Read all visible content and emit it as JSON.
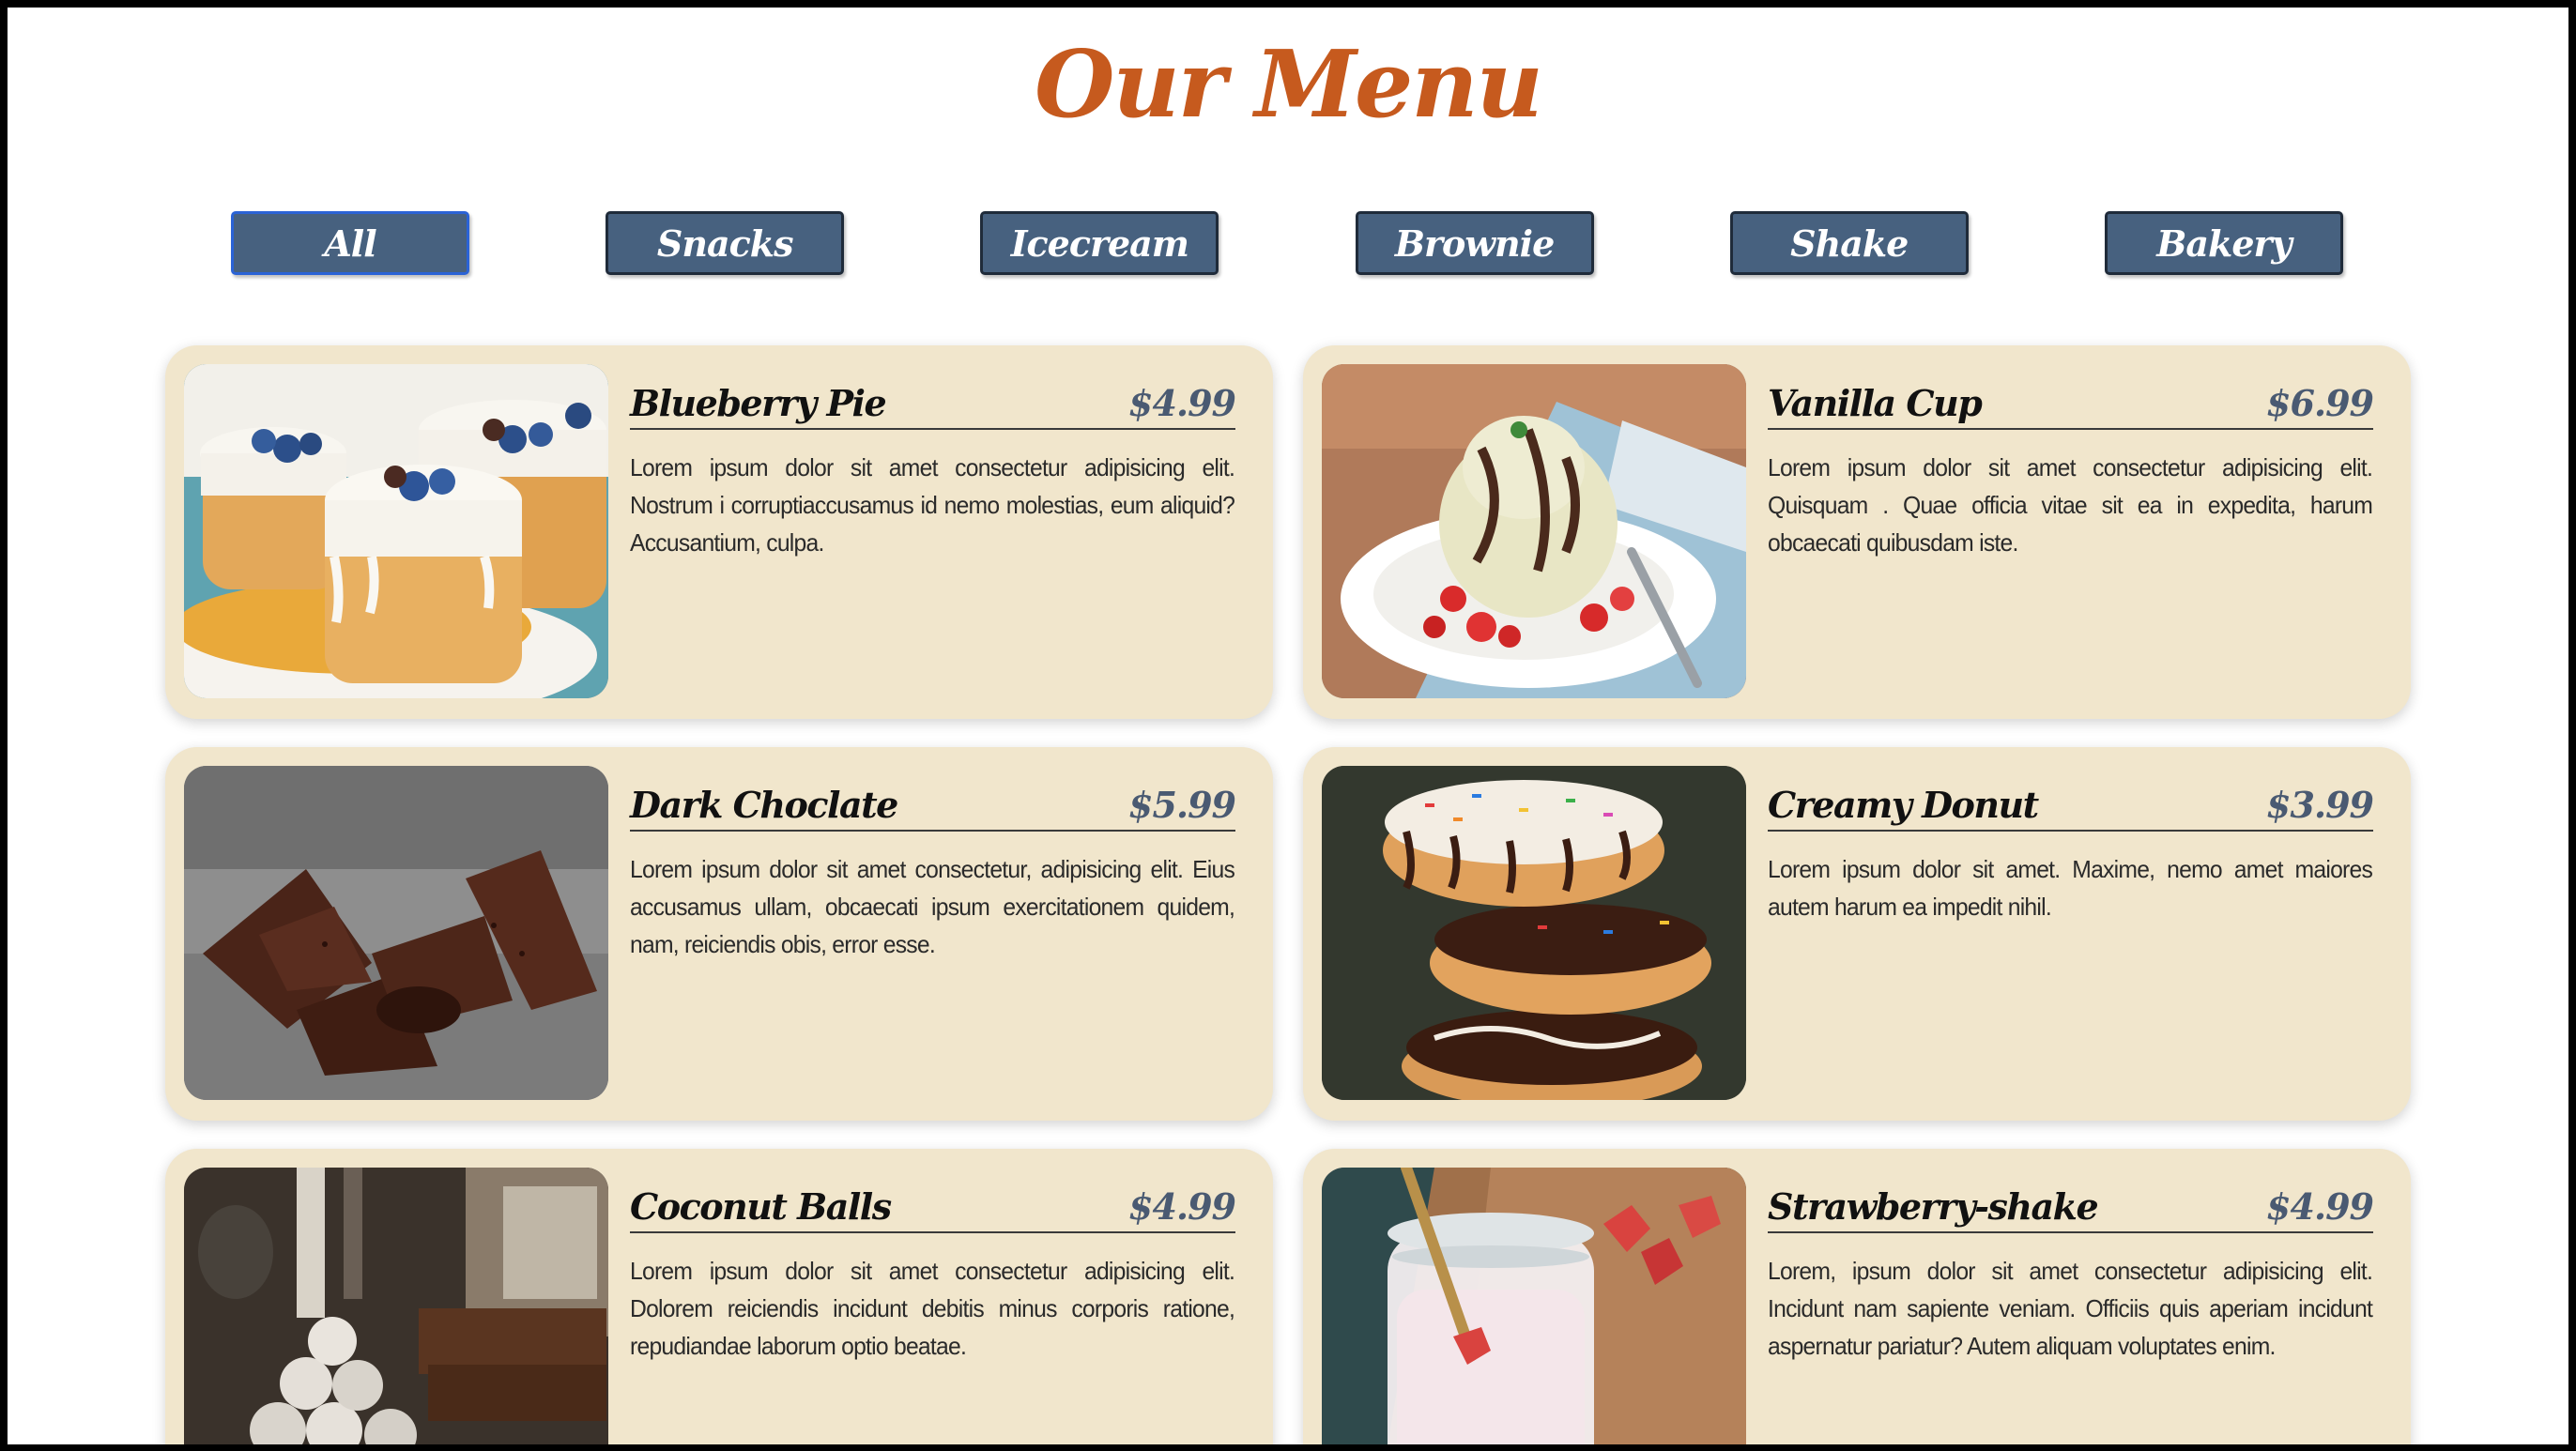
{
  "page": {
    "title": "Our Menu"
  },
  "filters": [
    {
      "label": "All",
      "active": true
    },
    {
      "label": "Snacks",
      "active": false
    },
    {
      "label": "Icecream",
      "active": false
    },
    {
      "label": "Brownie",
      "active": false
    },
    {
      "label": "Shake",
      "active": false
    },
    {
      "label": "Bakery",
      "active": false
    }
  ],
  "items": [
    {
      "name": "Blueberry Pie",
      "price": "$4.99",
      "image": "blueberry-pie-photo",
      "description": "Lorem ipsum dolor sit amet consectetur adipisicing elit. Nostrum i corruptiaccusamus id nemo molestias, eum aliquid? Accusantium, culpa."
    },
    {
      "name": "Vanilla Cup",
      "price": "$6.99",
      "image": "vanilla-icecream-photo",
      "description": "Lorem ipsum dolor sit amet consectetur adipisicing elit. Quisquam . Quae officia vitae sit ea in expedita, harum obcaecati quibusdam iste."
    },
    {
      "name": "Dark Choclate",
      "price": "$5.99",
      "image": "chocolate-brownie-photo",
      "description": "Lorem ipsum dolor sit amet consectetur, adipisicing elit. Eius accusamus ullam, obcaecati ipsum exercitationem quidem, nam, reiciendis obis, error esse."
    },
    {
      "name": "Creamy Donut",
      "price": "$3.99",
      "image": "donut-stack-photo",
      "description": "Lorem ipsum dolor sit amet. Maxime, nemo amet maiores autem harum ea impedit nihil."
    },
    {
      "name": "Coconut Balls",
      "price": "$4.99",
      "image": "coconut-balls-photo",
      "description": "Lorem ipsum dolor sit amet consectetur adipisicing elit. Dolorem reiciendis incidunt debitis minus corporis ratione, repudiandae laborum optio beatae."
    },
    {
      "name": "Strawberry-shake",
      "price": "$4.99",
      "image": "strawberry-shake-photo",
      "description": "Lorem, ipsum dolor sit amet consectetur adipisicing elit. Incidunt nam sapiente veniam. Officiis quis aperiam incidunt aspernatur pariatur? Autem aliquam voluptates enim."
    }
  ]
}
